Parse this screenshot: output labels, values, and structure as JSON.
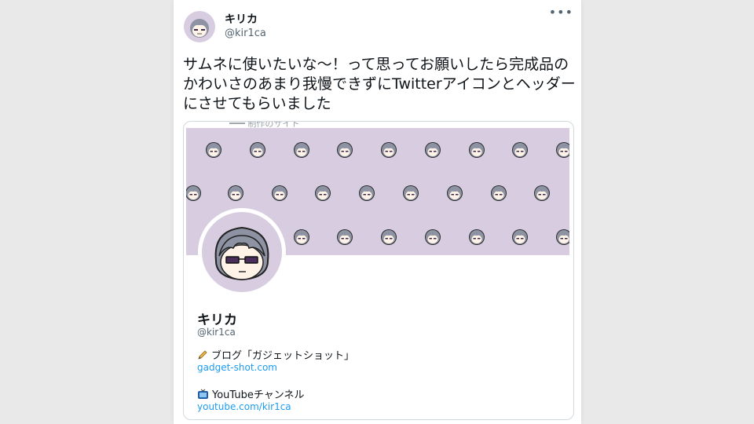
{
  "author": {
    "display_name": "キリカ",
    "handle": "@kir1ca",
    "avatar_icon": "chibi-character-avatar"
  },
  "tweet": {
    "text": "サムネに使いたいな〜！って思ってお願いしたら完成品のかわいさのあまり我慢できずにTwitterアイコンとヘッダーにさせてもらいました",
    "more_icon": "more-options-icon"
  },
  "card": {
    "partial_text": "━━━ 制作のサイト",
    "profile": {
      "display_name": "キリカ",
      "handle": "@kir1ca",
      "bio": [
        {
          "emoji": "pencil-icon",
          "text": "ブログ「ガジェットショット」",
          "link": "gadget-shot.com"
        },
        {
          "emoji": "tv-icon",
          "text": "YouTubeチャンネル",
          "link": "youtube.com/kir1ca"
        }
      ]
    }
  },
  "colors": {
    "banner": "#d8cde0",
    "link": "#1d9bf0",
    "secondary_text": "#536471",
    "hair": "#8d93a3"
  }
}
